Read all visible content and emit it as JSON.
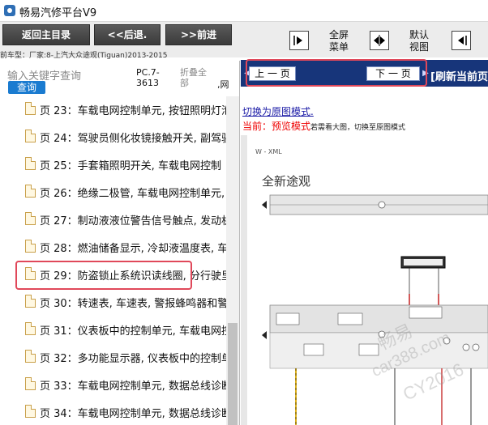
{
  "window": {
    "title": "畅易汽修平台V9"
  },
  "toolbar": {
    "back_home": "返回主目录",
    "back": "<<后退.",
    "forward": ">>前进",
    "fullscreen": "全屏\n菜单",
    "default_view": "默认\n视图"
  },
  "model_path": "前车型：厂家:8-上汽大众途观(Tiguan)2013-2015",
  "left": {
    "search_placeholder": "输入关键字查询",
    "search_button": "查询",
    "page_code": "PC.7-\n3613",
    "page_name": "折叠全\n部",
    "page_extra": ",网",
    "items": [
      {
        "label": "页 23：车载电网控制单元, 按钮照明灯泡"
      },
      {
        "label": "页 24：驾驶员侧化妆镜接触开关, 副驾驶"
      },
      {
        "label": "页 25：手套箱照明开关, 车载电网控制"
      },
      {
        "label": "页 26：绝缘二极管, 车载电网控制单元,"
      },
      {
        "label": "页 27：制动液液位警告信号触点, 发动机"
      },
      {
        "label": "页 28：燃油储备显示, 冷却液温度表, 车"
      },
      {
        "label": "页 29：防盗锁止系统识读线圈, 分行驶里"
      },
      {
        "label": "页 30：转速表, 车速表, 警报蜂鸣器和警"
      },
      {
        "label": "页 31：仪表板中的控制单元, 车载电网控"
      },
      {
        "label": "页 32：多功能显示器, 仪表板中的控制单"
      },
      {
        "label": "页 33：车载电网控制单元, 数据总线诊断"
      },
      {
        "label": "页 34：车载电网控制单元, 数据总线诊断"
      }
    ]
  },
  "right": {
    "prev_page": "上 一 页",
    "next_page": "下 一 页",
    "refresh": "[刷新当前页",
    "switch_link": "切换为原图模式.",
    "current_prefix": "当前：预览模式",
    "current_hint": "若需看大图，切换至原图模式",
    "diagram_tag": "W - XML",
    "car_name": "全新途观",
    "watermark_1": "畅易",
    "watermark_2": "car388.com",
    "watermark_3": "CY2016"
  },
  "colors": {
    "toolbar_btn": "#3f3f3f",
    "pager_bar": "#17357a",
    "search_btn": "#1a7bd0",
    "highlight": "#e0485a",
    "current_red": "#ee0000",
    "link_blue": "#1a1aa6"
  }
}
